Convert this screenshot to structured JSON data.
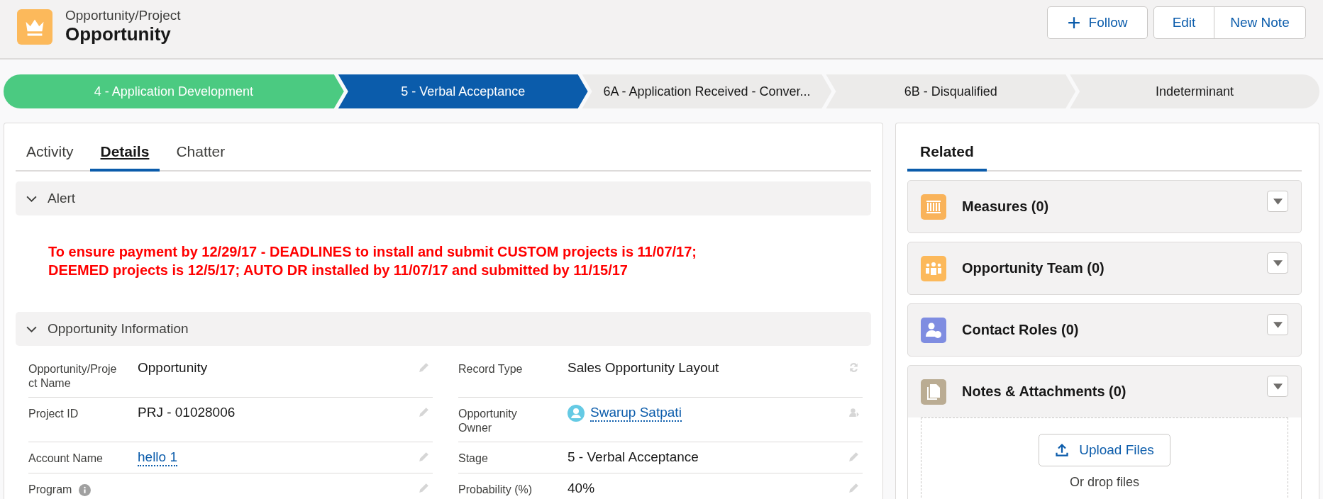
{
  "header": {
    "object_type": "Opportunity/Project",
    "title": "Opportunity",
    "buttons": [
      {
        "label": "Follow",
        "kind": "follow"
      },
      {
        "label": "Edit",
        "kind": "plain"
      },
      {
        "label": "New Note",
        "kind": "plain"
      }
    ]
  },
  "path": [
    {
      "label": "4 - Application Development",
      "completed": true,
      "selected": false
    },
    {
      "label": "5 - Verbal Acceptance",
      "completed": false,
      "selected": true
    },
    {
      "label": "6A - Application Received - Conver...",
      "completed": false,
      "selected": false
    },
    {
      "label": "6B - Disqualified",
      "completed": false,
      "selected": false
    },
    {
      "label": "Indeterminant",
      "completed": false,
      "selected": false
    }
  ],
  "tabs": [
    {
      "label": "Activity",
      "selected": false
    },
    {
      "label": "Details",
      "selected": true
    },
    {
      "label": "Chatter",
      "selected": false
    }
  ],
  "alert_section": {
    "title": "Alert",
    "expanded": true,
    "message": "To ensure payment by 12/29/17 - DEADLINES to install and submit CUSTOM projects is 11/07/17; DEEMED projects is 12/5/17; AUTO DR installed by 11/07/17 and submitted by 11/15/17"
  },
  "info_section": {
    "title": "Opportunity Information",
    "expanded": true,
    "fields": [
      [
        {
          "label": "Opportunity/Project Name",
          "value": "Opportunity",
          "kind": "text"
        },
        {
          "label": "Record Type",
          "value": "Sales Opportunity Layout",
          "kind": "record-type"
        }
      ],
      [
        {
          "label": "Project ID",
          "value": "PRJ - 01028006",
          "kind": "text"
        },
        {
          "label": "Opportunity Owner",
          "value": "Swarup Satpati",
          "kind": "user"
        }
      ],
      [
        {
          "label": "Account Name",
          "value": "hello 1",
          "kind": "link"
        },
        {
          "label": "Stage",
          "value": "5 - Verbal Acceptance",
          "kind": "text"
        }
      ],
      [
        {
          "label": "Program",
          "kind": "text",
          "info": true
        },
        {
          "label": "Probability (%)",
          "value": "40%",
          "kind": "text"
        }
      ]
    ]
  },
  "related": {
    "tab": "Related",
    "lists": [
      {
        "title": "Measures (0)",
        "kind": "measures",
        "color": "#f9b35a",
        "expanded": false
      },
      {
        "title": "Opportunity Team (0)",
        "kind": "team",
        "color": "#fcb95b",
        "expanded": false
      },
      {
        "title": "Contact Roles (0)",
        "kind": "contact",
        "color": "#7f8de1",
        "expanded": false
      },
      {
        "title": "Notes & Attachments (0)",
        "kind": "notes",
        "color": "#baac93",
        "expanded": true,
        "upload_button": "Upload Files",
        "drop_hint": "Or drop files"
      }
    ]
  }
}
